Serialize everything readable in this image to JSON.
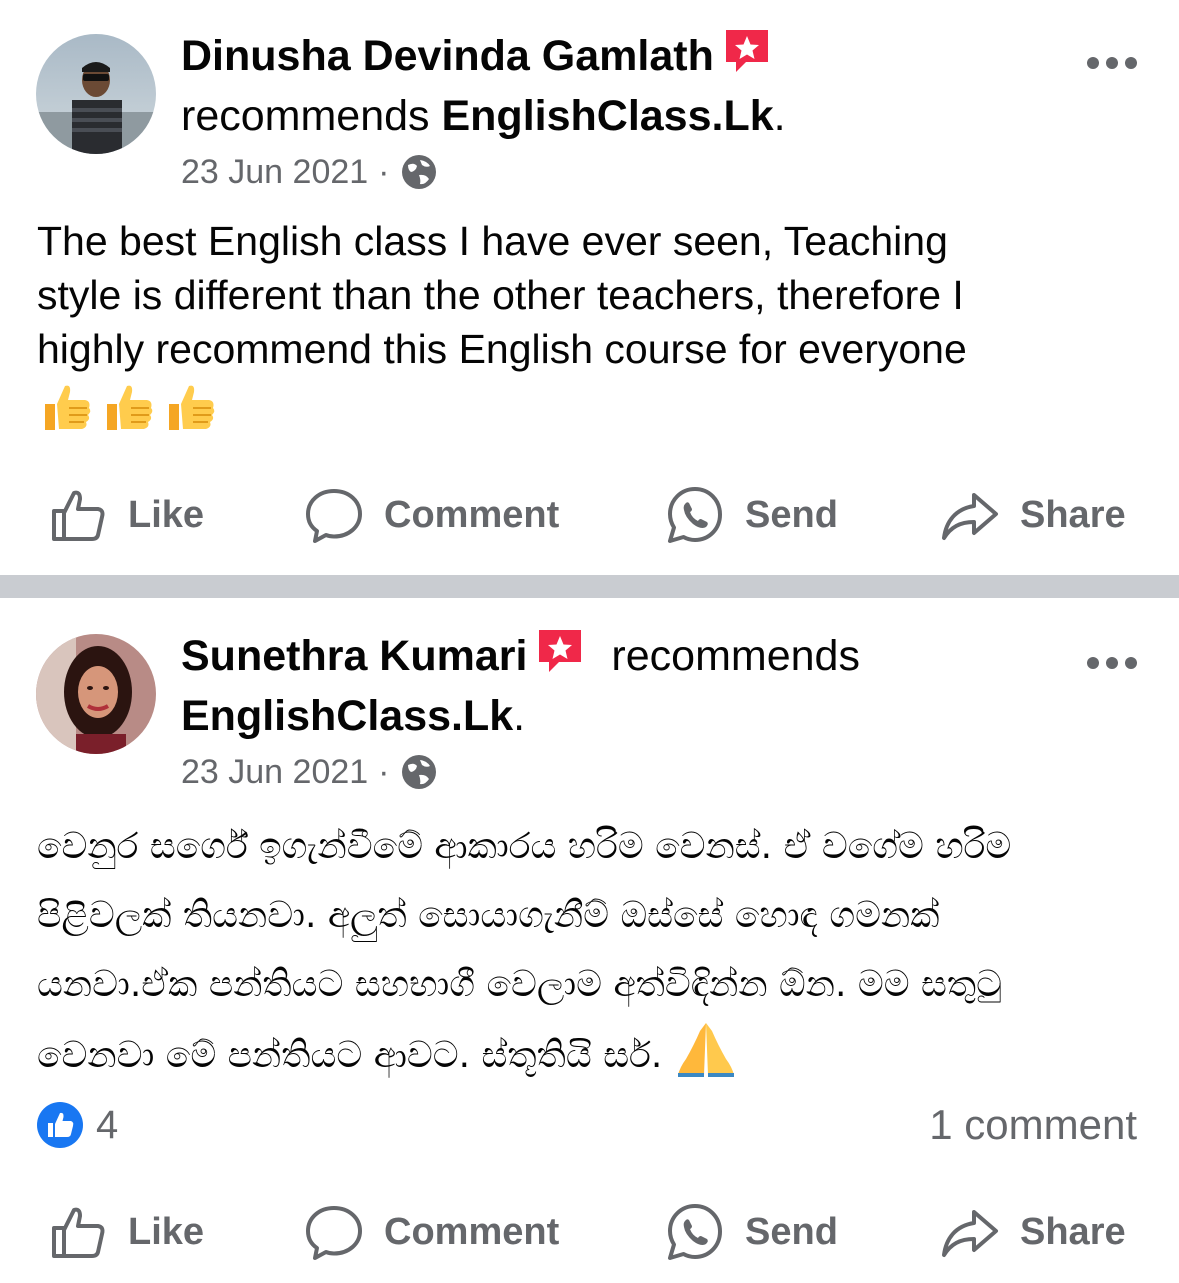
{
  "post1": {
    "author": "Dinusha Devinda Gamlath",
    "recommends_word": "recommends",
    "target": "EnglishClass.Lk",
    "period": ".",
    "date": "23 Jun 2021",
    "dot": "·",
    "text_lines": [
      "The best English class I have ever seen, Teaching",
      "style is different than the other teachers, therefore I",
      "highly recommend this English course for everyone"
    ],
    "emoji": [
      "thumbs-up",
      "thumbs-up",
      "thumbs-up"
    ]
  },
  "post2": {
    "author": "Sunethra Kumari",
    "recommends_word": "recommends",
    "target": "EnglishClass.Lk",
    "period": ".",
    "date": "23 Jun 2021",
    "dot": "·",
    "text_lines": [
      "වෙනුර සර්ගේ ඉගැන්වීමේ ආකාරය හරිම වෙනස්. ඒ වගේම හරිම",
      "පිළිවලක් තියනවා. අලුත් සොයාගැනීම් ඔස්සේ හොඳ ගමනක්",
      "යනවා.ඒක පන්තියට සහභාගී වෙලාම අත්විඳින්න ඕන. මම සතුටු",
      "වෙනවා මේ පන්තියට ආවට. ස්තූතියි සර්."
    ],
    "reaction_count": "4",
    "comment_count": "1 comment"
  },
  "actions": {
    "like": "Like",
    "comment": "Comment",
    "send": "Send",
    "share": "Share"
  },
  "colors": {
    "secondary_text": "#65676b",
    "divider": "#c9ccd1",
    "like_blue": "#1877f2",
    "badge_red": "#f02849"
  },
  "icons": [
    "star-badge-icon",
    "globe-icon",
    "more-icon",
    "like-icon",
    "comment-icon",
    "whatsapp-icon",
    "share-icon",
    "thumbs-up-emoji",
    "pray-emoji"
  ]
}
